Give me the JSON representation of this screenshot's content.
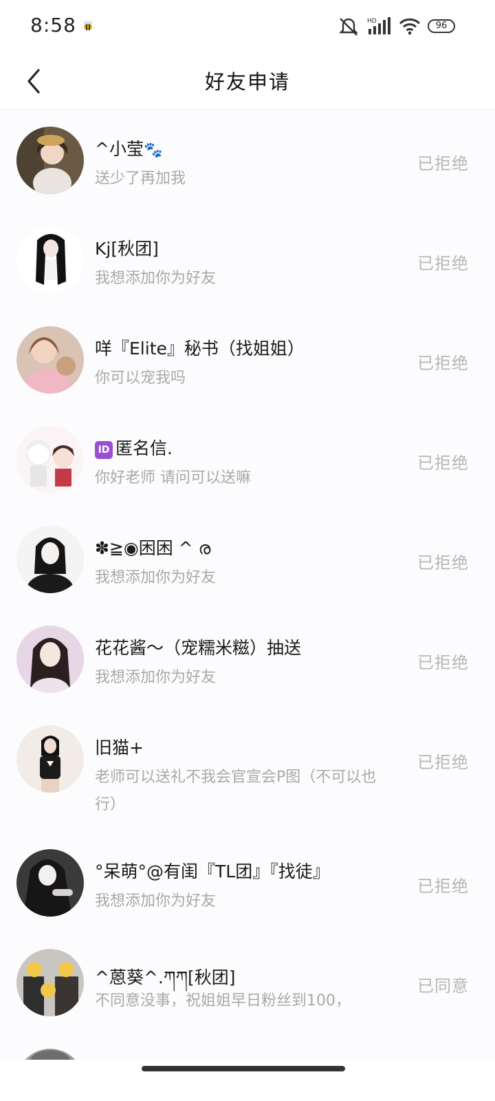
{
  "status_bar": {
    "time": "8:58",
    "battery": "96",
    "network": "HD"
  },
  "nav": {
    "title": "好友申请",
    "back_icon": "chevron-left-icon"
  },
  "requests": [
    {
      "name": "^小莹",
      "name_suffix": "🐾",
      "message": "送少了再加我",
      "status": "已拒绝"
    },
    {
      "name": "Kj[秋团]",
      "message": "我想添加你为好友",
      "status": "已拒绝"
    },
    {
      "name": "咩『Elite』秘书（找姐姐）",
      "message": "你可以宠我吗",
      "status": "已拒绝"
    },
    {
      "name_badge": "ID",
      "name": "匿名信.",
      "message": "你好老师 请问可以送嘛",
      "status": "已拒绝"
    },
    {
      "name": "✽≧◉困困 ^ ര",
      "message": "我想添加你为好友",
      "status": "已拒绝"
    },
    {
      "name": "花花酱～（宠糯米糍）抽送",
      "message": "我想添加你为好友",
      "status": "已拒绝"
    },
    {
      "name": "旧猫+",
      "message": "老师可以送礼不我会官宣会P图（不可以也行）",
      "status": "已拒绝"
    },
    {
      "name": "°呆萌°@有闺『TL团』『找徒』",
      "message": "我想添加你为好友",
      "status": "已拒绝"
    },
    {
      "name": "^蒽葵^.ཀཀ[秋团]",
      "message": "不同意没事，祝姐姐早日粉丝到100，",
      "status": "已同意"
    }
  ],
  "colors": {
    "status_text": "#b7b7b7",
    "message_text": "#a9a9a9",
    "name_text": "#1a1a1a"
  }
}
